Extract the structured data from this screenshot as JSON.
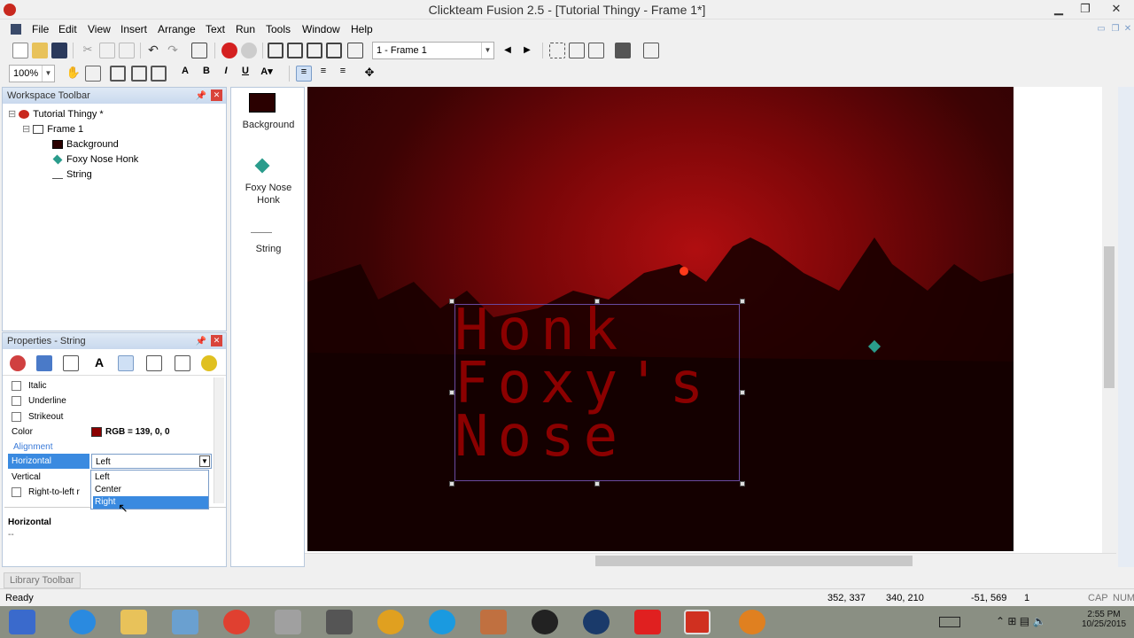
{
  "window": {
    "title": "Clickteam Fusion 2.5 - [Tutorial Thingy - Frame 1*]"
  },
  "menu": [
    "File",
    "Edit",
    "View",
    "Insert",
    "Arrange",
    "Text",
    "Run",
    "Tools",
    "Window",
    "Help"
  ],
  "toolbar": {
    "frame_select": "1 - Frame 1",
    "zoom": "100%"
  },
  "workspace": {
    "title": "Workspace Toolbar",
    "app": "Tutorial Thingy *",
    "frame": "Frame 1",
    "objects": [
      "Background",
      "Foxy Nose Honk",
      "String"
    ]
  },
  "properties": {
    "title": "Properties - String",
    "rows": {
      "italic": "Italic",
      "underline": "Underline",
      "strikeout": "Strikeout",
      "color_label": "Color",
      "color_value": "RGB = 139, 0, 0",
      "alignment_header": "Alignment",
      "horizontal_label": "Horizontal",
      "horizontal_value": "Left",
      "vertical_label": "Vertical",
      "rtl_label": "Right-to-left r"
    },
    "dropdown_options": [
      "Left",
      "Center",
      "Right"
    ],
    "selected_option": "Right",
    "help_title": "Horizontal",
    "help_text": "--"
  },
  "object_panel": [
    {
      "label": "Background"
    },
    {
      "label": "Foxy Nose Honk"
    },
    {
      "label": "String"
    }
  ],
  "canvas": {
    "string_text": "Honk\nFoxy's\nNose",
    "text_color": "#8b0000"
  },
  "library": {
    "tab": "Library Toolbar"
  },
  "status": {
    "left": "Ready",
    "coords": "352, 337",
    "size": "340, 210",
    "mouse": "-51, 569",
    "layer": "1",
    "caps": "CAP",
    "num": "NUM"
  },
  "clock": {
    "time": "2:55 PM",
    "date": "10/25/2015"
  }
}
